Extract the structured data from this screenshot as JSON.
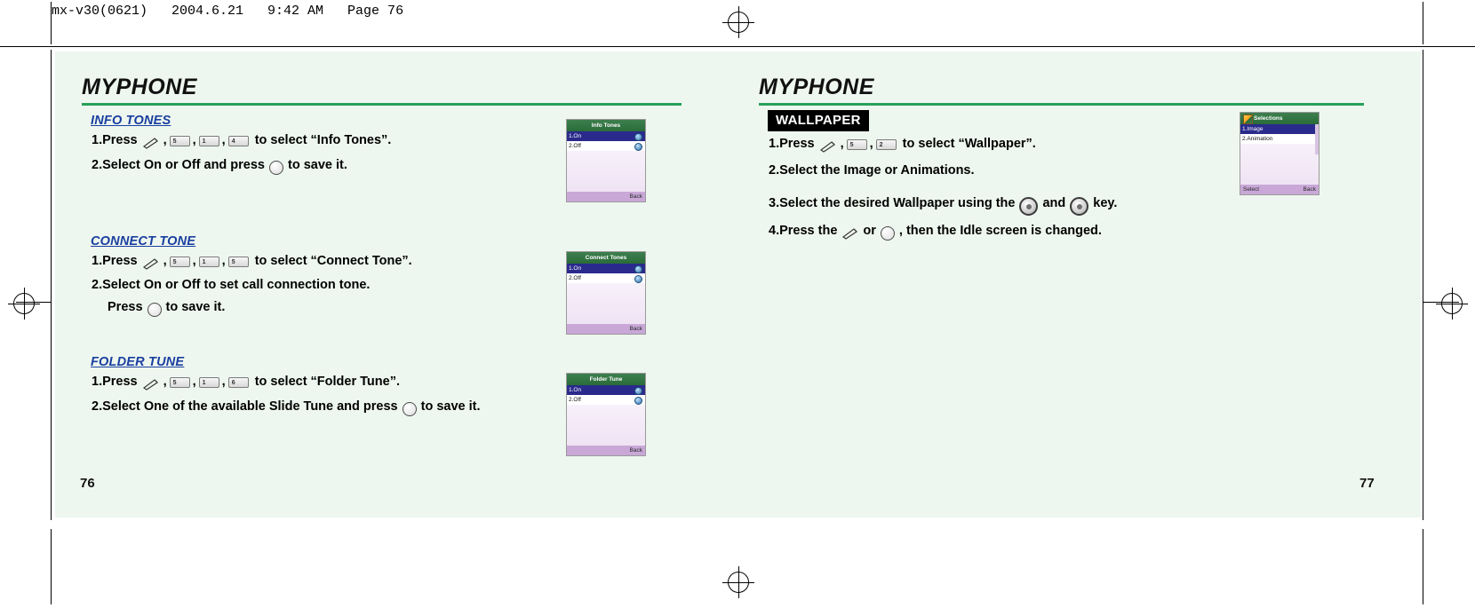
{
  "print_header": "mx-v30(0621)   2004.6.21   9:42 AM   Page 76",
  "left_page": {
    "brand": "MYPHONE",
    "page_number": "76",
    "sections": [
      {
        "heading": "INFO TONES",
        "steps": [
          {
            "prefix": "1.Press",
            "keys": [
              "send",
              "5",
              "1",
              "4"
            ],
            "suffix": "to select “Info Tones”."
          },
          {
            "prefix": "2.Select On or Off and press",
            "keys": [
              "ok"
            ],
            "suffix": "to save it."
          }
        ],
        "screen": {
          "title": "Info Tones",
          "items": [
            "1.On",
            "2.Off"
          ],
          "selected_index": 0,
          "soft_left": "",
          "soft_right": "Back"
        }
      },
      {
        "heading": "CONNECT TONE",
        "steps": [
          {
            "prefix": "1.Press",
            "keys": [
              "send",
              "5",
              "1",
              "5"
            ],
            "suffix": "to select “Connect Tone”."
          },
          {
            "prefix": "2.Select On or Off to set call connection tone.",
            "keys": [],
            "suffix": ""
          },
          {
            "prefix": "Press",
            "keys": [
              "ok"
            ],
            "suffix": "to save it."
          }
        ],
        "screen": {
          "title": "Connect Tones",
          "items": [
            "1.On",
            "2.Off"
          ],
          "selected_index": 0,
          "soft_left": "",
          "soft_right": "Back"
        }
      },
      {
        "heading": "FOLDER TUNE",
        "steps": [
          {
            "prefix": "1.Press",
            "keys": [
              "send",
              "5",
              "1",
              "6"
            ],
            "suffix": "to select “Folder Tune”."
          },
          {
            "prefix": "2.Select One of the available Slide Tune and press",
            "keys": [
              "ok"
            ],
            "suffix": "to save it."
          }
        ],
        "screen": {
          "title": "Folder Tune",
          "items": [
            "1.On",
            "2.Off"
          ],
          "selected_index": 0,
          "soft_left": "",
          "soft_right": "Back"
        }
      }
    ]
  },
  "right_page": {
    "brand": "MYPHONE",
    "page_number": "77",
    "section_tag": "WALLPAPER",
    "steps": [
      {
        "prefix": "1.Press",
        "keys": [
          "send",
          "5",
          "2"
        ],
        "suffix": "to select “Wallpaper”."
      },
      {
        "prefix": "2.Select the Image or Animations.",
        "keys": [],
        "suffix": ""
      },
      {
        "prefix": "3.Select the desired Wallpaper using the",
        "keys": [
          "nav"
        ],
        "mid": "and",
        "keys2": [
          "nav"
        ],
        "suffix": "key."
      },
      {
        "prefix": "4.Press the",
        "keys": [
          "send"
        ],
        "mid": "or",
        "keys2": [
          "ok"
        ],
        "suffix": ", then the Idle screen is changed."
      }
    ],
    "screen": {
      "title": "Selections",
      "items": [
        "1.Image",
        "2.Animation"
      ],
      "selected_index": 0,
      "soft_left": "Select",
      "soft_right": "Back"
    }
  },
  "key_labels": {
    "k1": "1",
    "k2": "2",
    "k4": "4",
    "k5": "5",
    "k6": "6"
  }
}
